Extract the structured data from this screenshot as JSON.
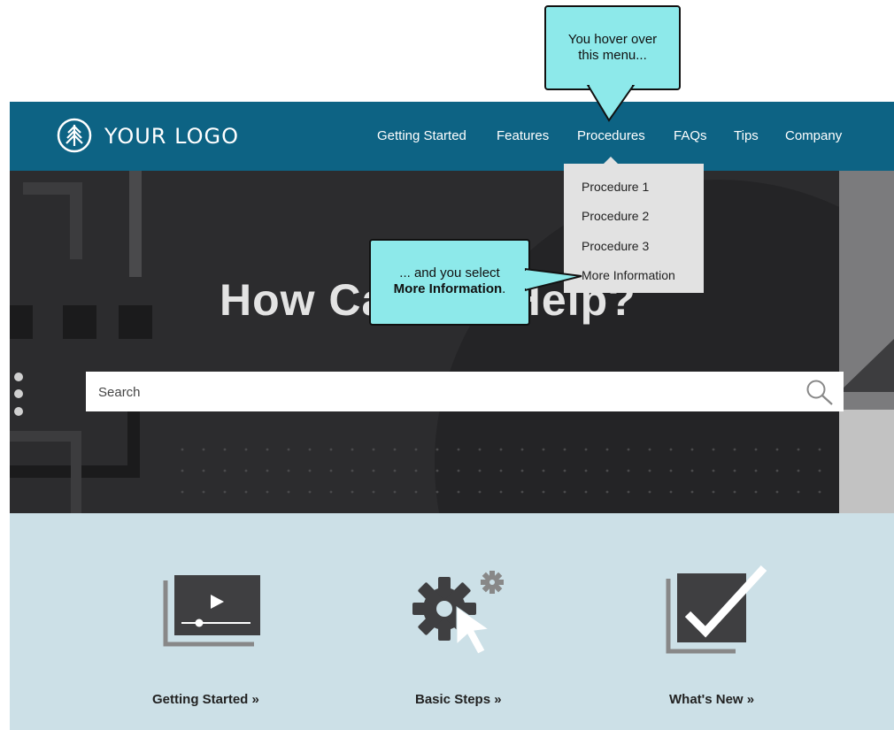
{
  "callouts": {
    "top_line1": "You hover over",
    "top_line2": "this menu...",
    "mid_line1": "... and you select",
    "mid_bold": "More Information",
    "mid_after": "."
  },
  "header": {
    "logo_text": "YOUR LOGO",
    "nav": [
      "Getting Started",
      "Features",
      "Procedures",
      "FAQs",
      "Tips",
      "Company"
    ]
  },
  "dropdown": {
    "items": [
      "Procedure 1",
      "Procedure 2",
      "Procedure 3",
      "More Information"
    ]
  },
  "hero": {
    "title": "How Can We Help?",
    "search_placeholder": "Search"
  },
  "tiles": [
    {
      "label": "Getting Started »",
      "icon": "video-player-icon"
    },
    {
      "label": "Basic Steps »",
      "icon": "gear-cursor-icon"
    },
    {
      "label": "What's New »",
      "icon": "checkmark-icon"
    }
  ],
  "colors": {
    "header": "#0d6384",
    "hero": "#2c2c2e",
    "callout": "#8de9ea",
    "lower": "#cce0e7",
    "dropdown": "#e2e2e2"
  }
}
